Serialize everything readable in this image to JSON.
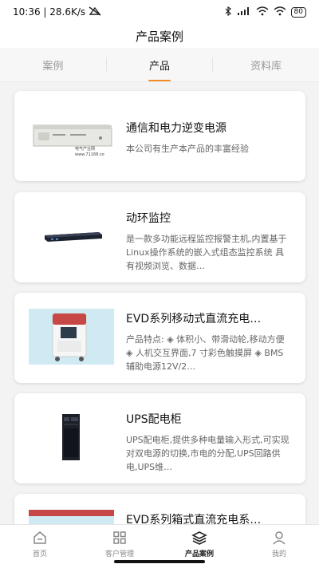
{
  "status": {
    "time": "10:36 | 28.6K/s",
    "battery": "80"
  },
  "header": {
    "title": "产品案例"
  },
  "tabs": [
    {
      "label": "案例"
    },
    {
      "label": "产品",
      "active": true
    },
    {
      "label": "资料库"
    }
  ],
  "products": [
    {
      "title": "通信和电力逆变电源",
      "desc": "本公司有生产本产品的丰富经验",
      "thumb_text": "电气产业网 www.71168.co"
    },
    {
      "title": "动环监控",
      "desc": "是一款多功能远程监控报警主机,内置基于Linux操作系统的嵌入式组态监控系统 具有视频浏览、数据…"
    },
    {
      "title": "EVD系列移动式直流充电…",
      "desc": "产品特点: ◈ 体积小、带滑动轮,移动方便 ◈ 人机交互界面,7 寸彩色触摸屏 ◈ BMS 辅助电源12V/2…"
    },
    {
      "title": "UPS配电柜",
      "desc": "UPS配电柜,提供多种电量输入形式,可实现对双电源的切换,市电的分配,UPS回路供电,UPS维…"
    },
    {
      "title": "EVD系列箱式直流充电系…",
      "desc": ""
    }
  ],
  "nav": [
    {
      "label": "首页",
      "icon": "home-icon"
    },
    {
      "label": "客户管理",
      "icon": "grid-icon"
    },
    {
      "label": "产品案例",
      "icon": "layers-icon",
      "active": true
    },
    {
      "label": "我的",
      "icon": "user-icon"
    }
  ],
  "colors": {
    "accent": "#f28c28",
    "thumb_bg": "#cfeaf2"
  }
}
